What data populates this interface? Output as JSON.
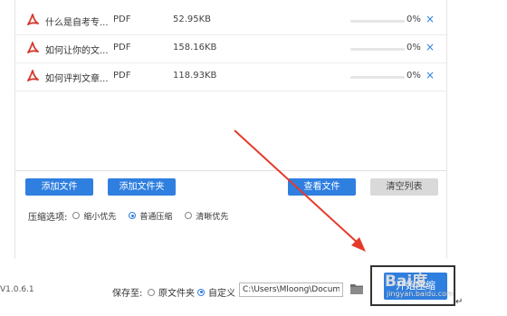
{
  "file_list": {
    "files": [
      {
        "name": "什么是自考专...",
        "type": "PDF",
        "size": "52.95KB",
        "progress_pct": 0,
        "progress_text": "0%",
        "remove": "×"
      },
      {
        "name": "如何让你的文...",
        "type": "PDF",
        "size": "158.16KB",
        "progress_pct": 0,
        "progress_text": "0%",
        "remove": "×"
      },
      {
        "name": "如何评判文章...",
        "type": "PDF",
        "size": "118.93KB",
        "progress_pct": 0,
        "progress_text": "0%",
        "remove": "×"
      }
    ],
    "file_icon": "pdf-icon"
  },
  "toolbar": {
    "add_file": "添加文件",
    "add_folder": "添加文件夹",
    "view_files": "查看文件",
    "clear_list": "清空列表"
  },
  "compress": {
    "label": "压缩选项:",
    "options": [
      {
        "label": "缩小优先",
        "selected": false
      },
      {
        "label": "普通压缩",
        "selected": true
      },
      {
        "label": "清晰优先",
        "selected": false
      }
    ]
  },
  "footer": {
    "version": "V1.0.6.1",
    "save_label": "保存至:",
    "save_options": [
      {
        "label": "原文件夹",
        "selected": false
      },
      {
        "label": "自定义",
        "selected": true
      }
    ],
    "path_value": "C:\\Users\\Mloong\\Documents",
    "folder_icon": "folder-icon",
    "start_label": "开始压缩"
  },
  "watermark": {
    "logo": "Bai度",
    "sub": "jingyan.baidu.com"
  },
  "colors": {
    "accent": "#2f7fe0",
    "arrow": "#e53a2a",
    "frame": "#333333"
  }
}
